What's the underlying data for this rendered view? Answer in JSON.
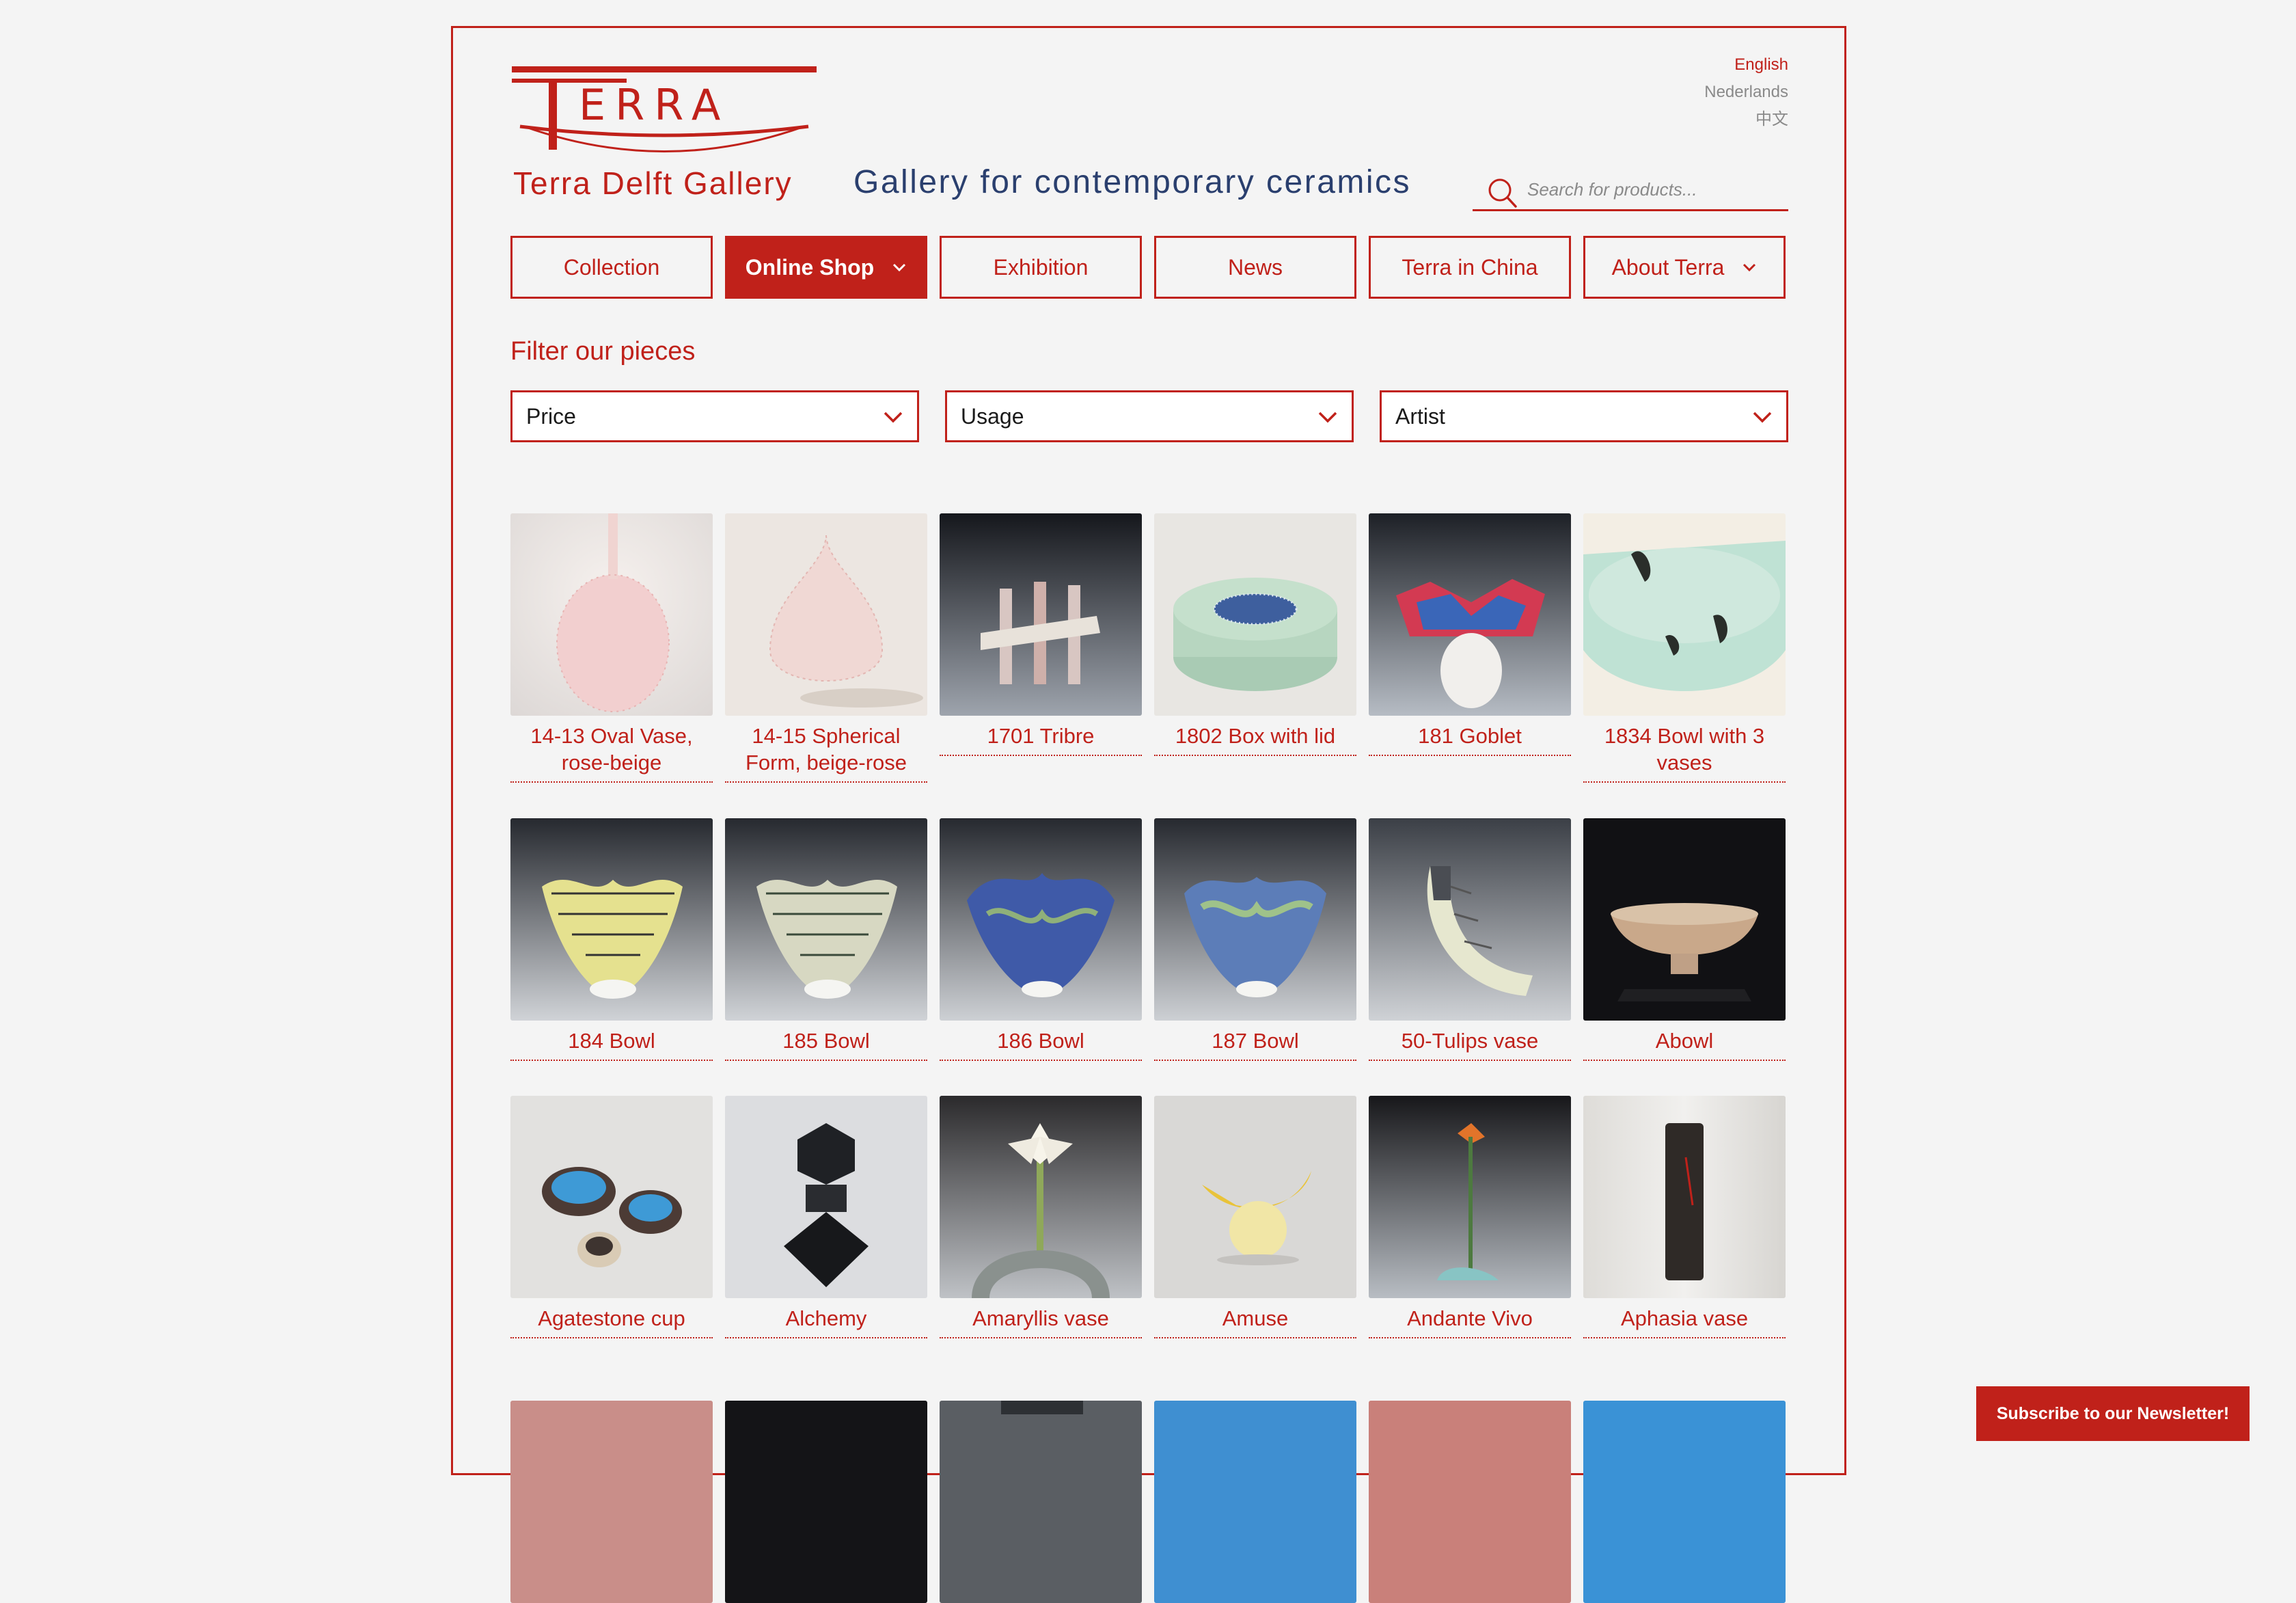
{
  "header": {
    "gallery_name": "Terra Delft Gallery",
    "tagline": "Gallery for contemporary ceramics",
    "languages": [
      {
        "label": "English",
        "active": true
      },
      {
        "label": "Nederlands",
        "active": false
      },
      {
        "label": "中文",
        "active": false
      }
    ],
    "search_placeholder": "Search for products..."
  },
  "nav": {
    "items": [
      {
        "label": "Collection",
        "active": false,
        "has_dropdown": false
      },
      {
        "label": "Online Shop",
        "active": true,
        "has_dropdown": true
      },
      {
        "label": "Exhibition",
        "active": false,
        "has_dropdown": false
      },
      {
        "label": "News",
        "active": false,
        "has_dropdown": false
      },
      {
        "label": "Terra in China",
        "active": false,
        "has_dropdown": false
      },
      {
        "label": "About Terra",
        "active": false,
        "has_dropdown": true
      }
    ]
  },
  "filter": {
    "title": "Filter our pieces",
    "selects": [
      {
        "label": "Price"
      },
      {
        "label": "Usage"
      },
      {
        "label": "Artist"
      }
    ]
  },
  "products": [
    {
      "name": "14-13 Oval Vase, rose-beige"
    },
    {
      "name": "14-15 Spherical Form, beige-rose"
    },
    {
      "name": "1701 Tribre"
    },
    {
      "name": "1802 Box with lid"
    },
    {
      "name": "181 Goblet"
    },
    {
      "name": "1834 Bowl with 3 vases"
    },
    {
      "name": "184 Bowl"
    },
    {
      "name": "185 Bowl"
    },
    {
      "name": "186 Bowl"
    },
    {
      "name": "187 Bowl"
    },
    {
      "name": "50-Tulips vase"
    },
    {
      "name": "Abowl"
    },
    {
      "name": "Agatestone cup"
    },
    {
      "name": "Alchemy"
    },
    {
      "name": "Amaryllis vase"
    },
    {
      "name": "Amuse"
    },
    {
      "name": "Andante Vivo"
    },
    {
      "name": "Aphasia vase"
    }
  ],
  "newsletter": {
    "label": "Subscribe to our Newsletter!"
  },
  "colors": {
    "accent": "#c0211a",
    "tagline": "#2a3f6e",
    "background": "#f4f4f4"
  }
}
